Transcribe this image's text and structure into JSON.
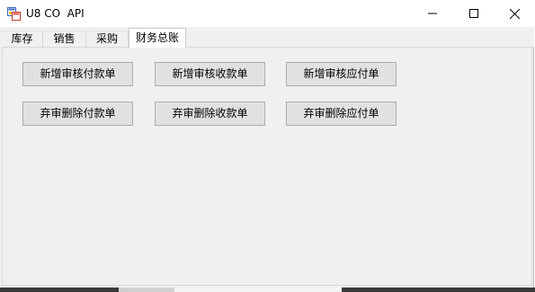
{
  "window": {
    "title": "U8 CO  API",
    "icon": "windows-forms-app-icon",
    "caption_buttons": [
      "minimize-icon",
      "maximize-icon",
      "close-icon"
    ]
  },
  "tabs": [
    {
      "label": "库存",
      "active": false
    },
    {
      "label": "销售",
      "active": false
    },
    {
      "label": "采购",
      "active": false
    },
    {
      "label": "财务总账",
      "active": true
    }
  ],
  "buttons": {
    "row1": [
      "新增审核付款单",
      "新增审核收款单",
      "新增审核应付单"
    ],
    "row2": [
      "弃审删除付款单",
      "弃审删除收款单",
      "弃审删除应付单"
    ]
  },
  "colors": {
    "window_bg": "#f0f0f0",
    "button_bg": "#e1e1e1",
    "button_border": "#adadad"
  }
}
